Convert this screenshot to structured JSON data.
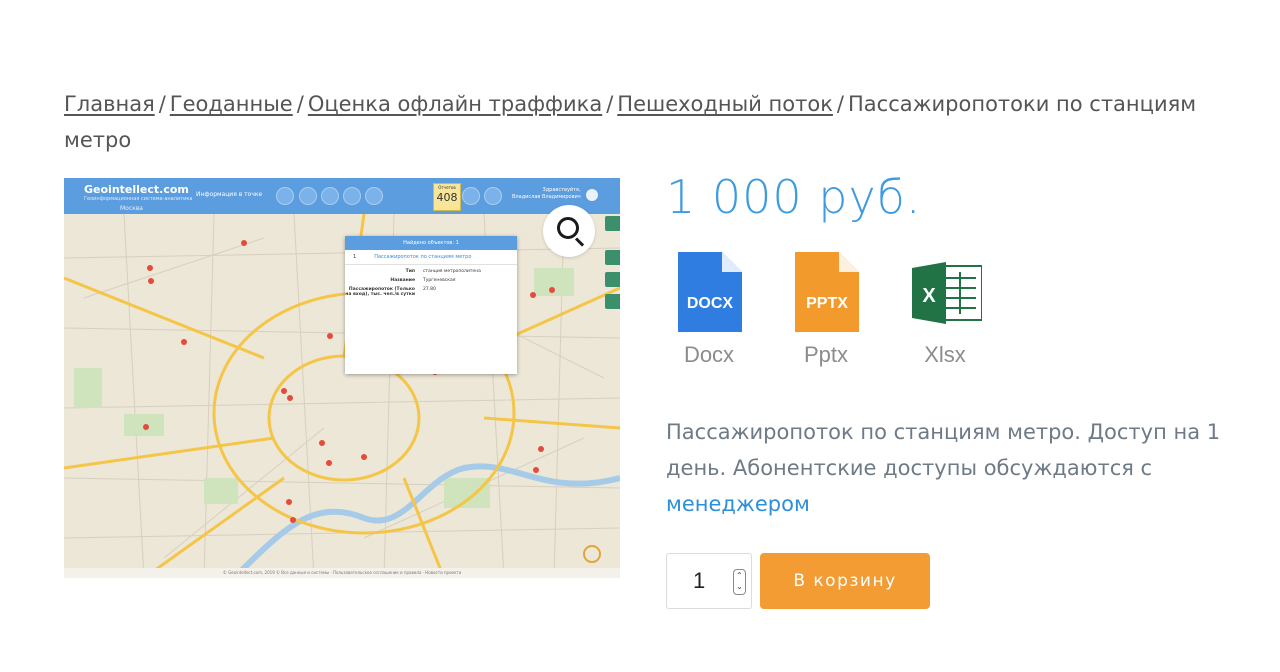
{
  "breadcrumb": {
    "items": [
      "Главная",
      "Геоданные",
      "Оценка офлайн траффика",
      "Пешеходный поток"
    ],
    "separator": "/",
    "current": "Пассажиропотоки по станциям метро"
  },
  "preview": {
    "logo": "Geointellect.com",
    "logo_sub": "Геоинформационная система-аналитика",
    "city": "Москва",
    "info_selector": "Информация в точке",
    "counter_label": "Отчетов",
    "counter_value": "408",
    "user_greeting": "Здравствуйте,",
    "user_name": "Владислав Владимирович",
    "popup_title": "Найдено объектов: 1",
    "popup_page": "1",
    "popup_link": "Пассажиропоток по станциям метро",
    "popup_rows": [
      {
        "key": "Тип",
        "value": "станция метрополитена"
      },
      {
        "key": "Название",
        "value": "Тургеневская"
      },
      {
        "key": "Пассажиропоток (Только на вход), тыс. чел./в сутки",
        "value": "27.80"
      }
    ],
    "footer": "© Geointellect.com, 2019 © Все данные и системы · Пользовательское соглашение и правила · Новости проекта",
    "zoom_icon": "magnifier-icon"
  },
  "price": "1 000 руб.",
  "formats": [
    {
      "label": "Docx",
      "badge": "DOCX",
      "color": "#2f7de1"
    },
    {
      "label": "Pptx",
      "badge": "PPTX",
      "color": "#f39a2c"
    },
    {
      "label": "Xlsx",
      "badge": "X",
      "color": "#217346"
    }
  ],
  "description": {
    "text": "Пассажиропоток по станциям метро. Доступ на 1 день. Абонентские доступы обсуждаются с",
    "link": "менеджером"
  },
  "quantity": "1",
  "cart_button": "В корзину"
}
